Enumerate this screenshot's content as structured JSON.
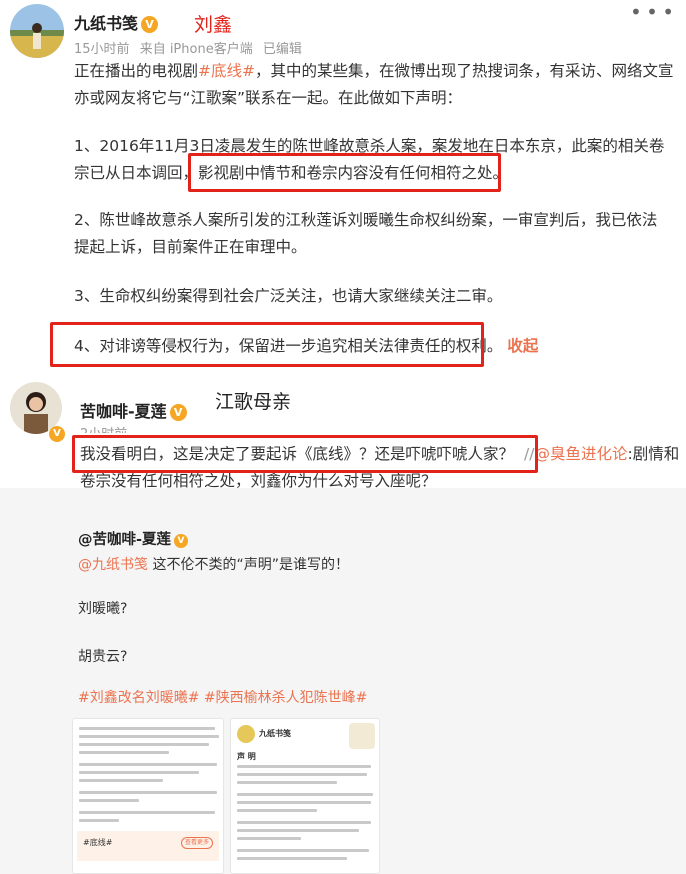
{
  "post1": {
    "user_name": "九纸书笺",
    "overlay_label": "刘鑫",
    "meta": {
      "time": "15小时前",
      "source": "来自 iPhone客户端",
      "edited": "已编辑"
    },
    "intro_1a": "正在播出的电视剧",
    "intro_hashtag": "#底线#",
    "intro_1b": "，其中的某些集，在微博出现了热搜词条，有采访、网络文宣",
    "intro_2": "亦或网友将它与“江歌案”联系在一起。在此做如下声明：",
    "p1_line1": "1、2016年11月3日凌晨发生的陈世峰故意杀人案，案发地在日本东京，此案的相关卷",
    "p1_line2a": "宗已从日本调回，",
    "p1_line2b": "影视剧中情节和卷宗内容没有任何相符之处。",
    "p2_line1": "2、陈世峰故意杀人案所引发的江秋莲诉刘暖曦生命权纠纷案，一审宣判后，我已依法",
    "p2_line2": "提起上诉，目前案件正在审理中。",
    "p3": "3、生命权纠纷案得到社会广泛关注，也请大家继续关注二审。",
    "p4": "4、对诽谤等侵权行为，保留进一步追究相关法律责任的权利。",
    "collapse_link": "收起"
  },
  "post2": {
    "user_name": "苦咖啡-夏莲",
    "overlay_label": "江歌母亲",
    "time": "2小时前",
    "line1a": "我没看明白，这是决定了要起诉《底线》？还是吓唬吓唬人家？",
    "line1_sep": "//",
    "line1_mention": "@臭鱼进化论",
    "line1b": ":剧情和",
    "line2": "卷宗没有任何相符之处，刘鑫你为什么对号入座呢？"
  },
  "embed": {
    "user_name": "@苦咖啡-夏莲",
    "mention": "@九纸书笺",
    "line1": " 这不伦不类的“声明”是谁写的！",
    "line2": "刘暖曦?",
    "line3": "胡贵云?",
    "hashtags": "#刘鑫改名刘暖曦# #陕西榆林杀人犯陈世峰#",
    "thumb1": {
      "tag": "#底线#",
      "button": "查看更多"
    },
    "thumb2": {
      "title": "九纸书笺",
      "heading": "声  明"
    }
  },
  "colors": {
    "accent": "#eb7350",
    "highlight_box": "#e2231a",
    "verified_badge": "#f5a623",
    "meta_text": "#999999"
  },
  "icons": [
    "more-options-icon",
    "verified-badge-icon"
  ]
}
